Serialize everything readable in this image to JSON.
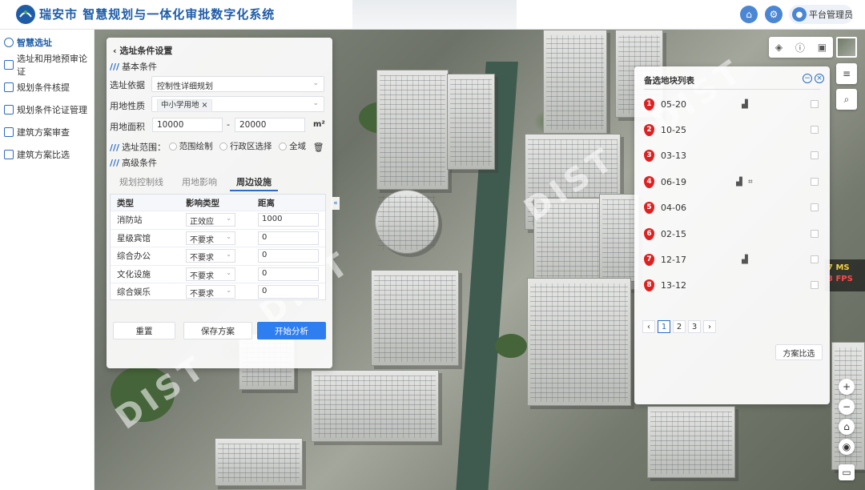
{
  "header": {
    "app_city": "瑞安市",
    "app_title": "智慧规划与一体化审批数字化系统",
    "user_name": "平台管理员"
  },
  "sidebar": {
    "items": [
      {
        "label": "智慧选址",
        "active": true
      },
      {
        "label": "选址和用地预审论证"
      },
      {
        "label": "规划条件核提"
      },
      {
        "label": "规划条件论证管理"
      },
      {
        "label": "建筑方案审查"
      },
      {
        "label": "建筑方案比选"
      }
    ]
  },
  "condition_panel": {
    "title": "选址条件设置",
    "basic_section": "基本条件",
    "basis_label": "选址依据",
    "basis_value": "控制性详细规划",
    "nature_label": "用地性质",
    "nature_tag": "中小学用地",
    "area_label": "用地面积",
    "area_min": "10000",
    "area_sep": "-",
    "area_max": "20000",
    "area_unit": "m²",
    "range_label": "选址范围：",
    "range_options": [
      "范围绘制",
      "行政区选择",
      "全域"
    ],
    "advanced_section": "高级条件",
    "tabs": [
      "规划控制线",
      "用地影响",
      "周边设施"
    ],
    "active_tab": "周边设施",
    "table_headers": [
      "类型",
      "影响类型",
      "距离"
    ],
    "table_rows": [
      {
        "type": "消防站",
        "effect": "正效应",
        "distance": "1000"
      },
      {
        "type": "星级宾馆",
        "effect": "不要求",
        "distance": "0"
      },
      {
        "type": "综合办公",
        "effect": "不要求",
        "distance": "0"
      },
      {
        "type": "文化设施",
        "effect": "不要求",
        "distance": "0"
      },
      {
        "type": "综合娱乐",
        "effect": "不要求",
        "distance": "0"
      }
    ],
    "reset_label": "重置",
    "save_label": "保存方案",
    "start_label": "开始分析"
  },
  "candidate_panel": {
    "title": "备选地块列表",
    "items": [
      {
        "num": "1",
        "code": "05-20",
        "building_icon": true,
        "scan_icon": false
      },
      {
        "num": "2",
        "code": "10-25",
        "building_icon": false,
        "scan_icon": false
      },
      {
        "num": "3",
        "code": "03-13",
        "building_icon": false,
        "scan_icon": false
      },
      {
        "num": "4",
        "code": "06-19",
        "building_icon": true,
        "scan_icon": true
      },
      {
        "num": "5",
        "code": "04-06",
        "building_icon": false,
        "scan_icon": false
      },
      {
        "num": "6",
        "code": "02-15",
        "building_icon": false,
        "scan_icon": false
      },
      {
        "num": "7",
        "code": "12-17",
        "building_icon": true,
        "scan_icon": false
      },
      {
        "num": "8",
        "code": "13-12",
        "building_icon": false,
        "scan_icon": false
      }
    ],
    "pages": [
      "1",
      "2",
      "3"
    ],
    "active_page": "1",
    "compare_label": "方案比选"
  },
  "map": {
    "watermark": "DIST",
    "stats_ms": "7 MS",
    "stats_fps": "3 FPS"
  },
  "colors": {
    "brand": "#1e5ca8",
    "accent": "#2f7ef0",
    "pin": "#e02020"
  }
}
